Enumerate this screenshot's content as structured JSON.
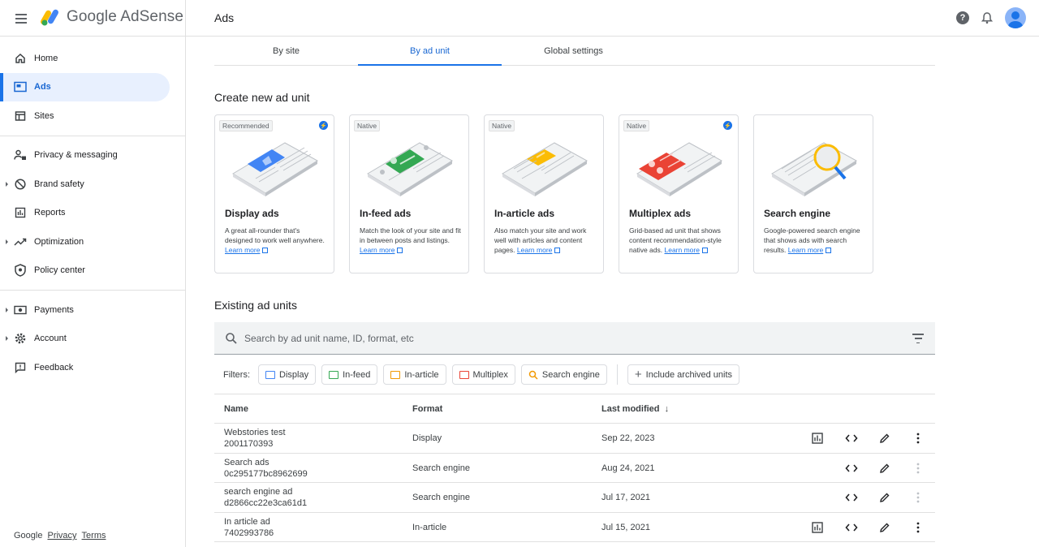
{
  "app": {
    "name": "Google AdSense",
    "page_title": "Ads"
  },
  "sidebar": {
    "items": [
      {
        "label": "Home",
        "icon": "home-icon",
        "active": false,
        "expandable": false
      },
      {
        "label": "Ads",
        "icon": "ads-icon",
        "active": true,
        "expandable": false
      },
      {
        "label": "Sites",
        "icon": "sites-icon",
        "active": false,
        "expandable": false
      },
      {
        "label": "Privacy & messaging",
        "icon": "privacy-icon",
        "active": false,
        "expandable": false
      },
      {
        "label": "Brand safety",
        "icon": "brand-safety-icon",
        "active": false,
        "expandable": true
      },
      {
        "label": "Reports",
        "icon": "reports-icon",
        "active": false,
        "expandable": false
      },
      {
        "label": "Optimization",
        "icon": "optimization-icon",
        "active": false,
        "expandable": true
      },
      {
        "label": "Policy center",
        "icon": "policy-icon",
        "active": false,
        "expandable": false
      },
      {
        "label": "Payments",
        "icon": "payments-icon",
        "active": false,
        "expandable": true
      },
      {
        "label": "Account",
        "icon": "account-icon",
        "active": false,
        "expandable": true
      },
      {
        "label": "Feedback",
        "icon": "feedback-icon",
        "active": false,
        "expandable": false
      }
    ],
    "footer": {
      "brand": "Google",
      "privacy": "Privacy",
      "terms": "Terms"
    }
  },
  "tabs": [
    {
      "label": "By site",
      "active": false
    },
    {
      "label": "By ad unit",
      "active": true
    },
    {
      "label": "Global settings",
      "active": false
    }
  ],
  "create_section": {
    "title": "Create new ad unit",
    "cards": [
      {
        "badge": "Recommended",
        "bolt": true,
        "title": "Display ads",
        "desc": "A great all-rounder that's designed to work well anywhere.",
        "learn_more": "Learn more",
        "color": "#4285f4"
      },
      {
        "badge": "Native",
        "bolt": false,
        "title": "In-feed ads",
        "desc": "Match the look of your site and fit in between posts and listings.",
        "learn_more": "Learn more",
        "color": "#34a853"
      },
      {
        "badge": "Native",
        "bolt": false,
        "title": "In-article ads",
        "desc": "Also match your site and work well with articles and content pages.",
        "learn_more": "Learn more",
        "color": "#fbbc04"
      },
      {
        "badge": "Native",
        "bolt": true,
        "title": "Multiplex ads",
        "desc": "Grid-based ad unit that shows content recommendation-style native ads.",
        "learn_more": "Learn more",
        "color": "#ea4335"
      },
      {
        "badge": "",
        "bolt": false,
        "title": "Search engine",
        "desc": "Google-powered search engine that shows ads with search results.",
        "learn_more": "Learn more",
        "color": "#fbbc04"
      }
    ]
  },
  "existing_section": {
    "title": "Existing ad units",
    "search_placeholder": "Search by ad unit name, ID, format, etc",
    "filters_label": "Filters:",
    "filters": [
      {
        "label": "Display",
        "color": "#4285f4"
      },
      {
        "label": "In-feed",
        "color": "#34a853"
      },
      {
        "label": "In-article",
        "color": "#f29900"
      },
      {
        "label": "Multiplex",
        "color": "#ea4335"
      },
      {
        "label": "Search engine",
        "color": "#f29900"
      }
    ],
    "include_archived": "Include archived units",
    "columns": {
      "name": "Name",
      "format": "Format",
      "modified": "Last modified"
    },
    "rows": [
      {
        "name": "Webstories test",
        "id": "2001170393",
        "format": "Display",
        "modified": "Sep 22, 2023",
        "has_report": true,
        "more_enabled": true
      },
      {
        "name": "Search ads",
        "id": "0c295177bc8962699",
        "format": "Search engine",
        "modified": "Aug 24, 2021",
        "has_report": false,
        "more_enabled": false
      },
      {
        "name": "search engine ad",
        "id": "d2866cc22e3ca61d1",
        "format": "Search engine",
        "modified": "Jul 17, 2021",
        "has_report": false,
        "more_enabled": false
      },
      {
        "name": "In article ad",
        "id": "7402993786",
        "format": "In-article",
        "modified": "Jul 15, 2021",
        "has_report": true,
        "more_enabled": true
      }
    ]
  }
}
